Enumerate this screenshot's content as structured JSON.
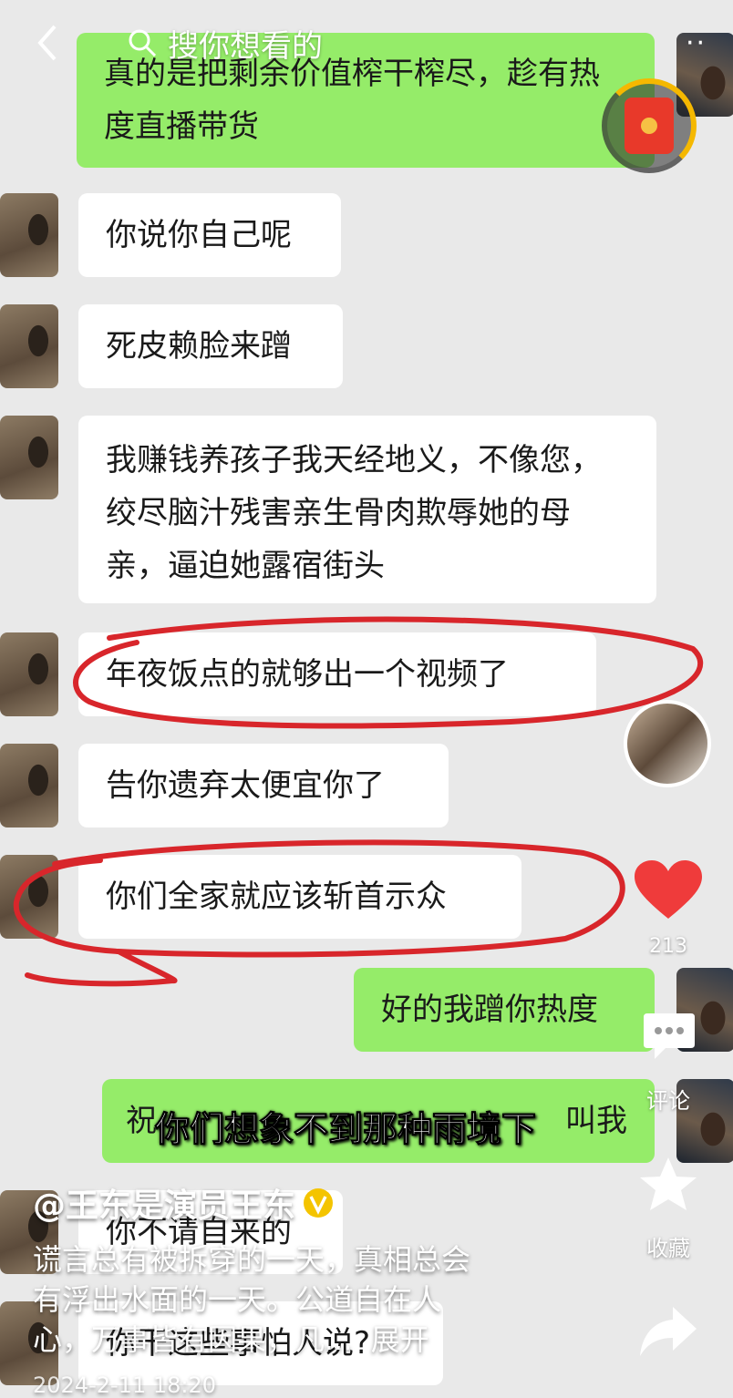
{
  "header": {
    "search_placeholder": "搜你想看的",
    "more_label": "··"
  },
  "messages": [
    {
      "text": "真的是把剩余价值榨干榨尽，趁有热度直播带货",
      "side": "self"
    },
    {
      "text": "你说你自己呢",
      "side": "other"
    },
    {
      "text": "死皮赖脸来蹭",
      "side": "other"
    },
    {
      "text": "我赚钱养孩子我天经地义，不像您，绞尽脑汁残害亲生骨肉欺辱她的母亲，逼迫她露宿街头",
      "side": "other"
    },
    {
      "text": "年夜饭点的就够出一个视频了",
      "side": "other"
    },
    {
      "text": "告你遗弃太便宜你了",
      "side": "other"
    },
    {
      "text": "你们全家就应该斩首示众",
      "side": "other"
    },
    {
      "text": "好的我蹭你热度",
      "side": "self"
    },
    {
      "text": "祝",
      "side": "self"
    },
    {
      "text": "叫我",
      "side": "self"
    },
    {
      "text": "你不请自来的",
      "side": "other"
    },
    {
      "text": "你干这些事怕人说?",
      "side": "other"
    }
  ],
  "side_actions": {
    "like_count": "213",
    "comment_label": "评论",
    "collect_label": "收藏"
  },
  "overlay": {
    "subtitle": "你们想象不到那种雨境下",
    "author": "@王东是演员王东",
    "description_lines": [
      "谎言总有被拆穿的一天，真相总会",
      "有浮出水面的一天。公道自在人",
      "心，万事皆有因果，凡..."
    ],
    "expand_label": "展开",
    "date": "2024-2-11 18:20"
  },
  "colors": {
    "self_bubble": "#95ec69",
    "other_bubble": "#ffffff",
    "annotation_red": "#d8262b",
    "like_red": "#ef3b3b"
  }
}
